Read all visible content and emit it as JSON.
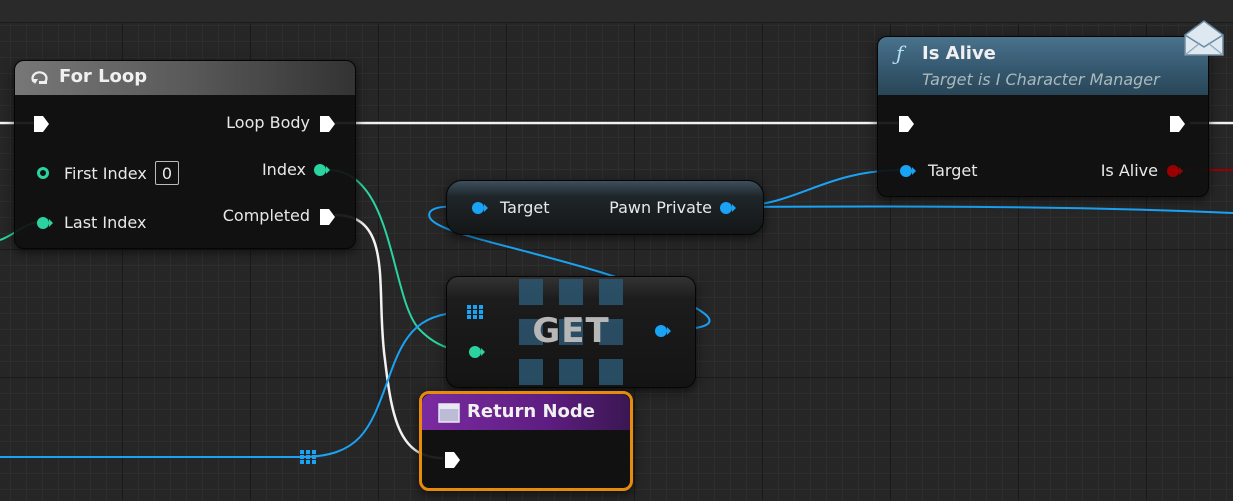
{
  "nodes": {
    "for_loop": {
      "title": "For Loop",
      "loop_body": "Loop Body",
      "index": "Index",
      "completed": "Completed",
      "first_index": "First Index",
      "first_index_value": "0",
      "last_index": "Last Index"
    },
    "get_pawn": {
      "target": "Target",
      "pawn_private": "Pawn Private"
    },
    "get_array": {
      "label": "GET"
    },
    "is_alive": {
      "title": "Is Alive",
      "subtitle": "Target is I Character Manager",
      "target": "Target",
      "is_alive": "Is Alive"
    },
    "return_node": {
      "title": "Return Node"
    }
  },
  "colors": {
    "exec": "#ffffff",
    "integer": "#2ad3a0",
    "object": "#1aa3f5",
    "boolean": "#9b0000",
    "return_header": "#5e1d82",
    "return_border": "#e88a0c",
    "function_header": "#35607a"
  },
  "icons": {
    "for_loop": "loop-icon",
    "is_alive": "function-icon",
    "return_node": "window-icon",
    "comment": "envelope-icon",
    "array": "grid-icon"
  }
}
